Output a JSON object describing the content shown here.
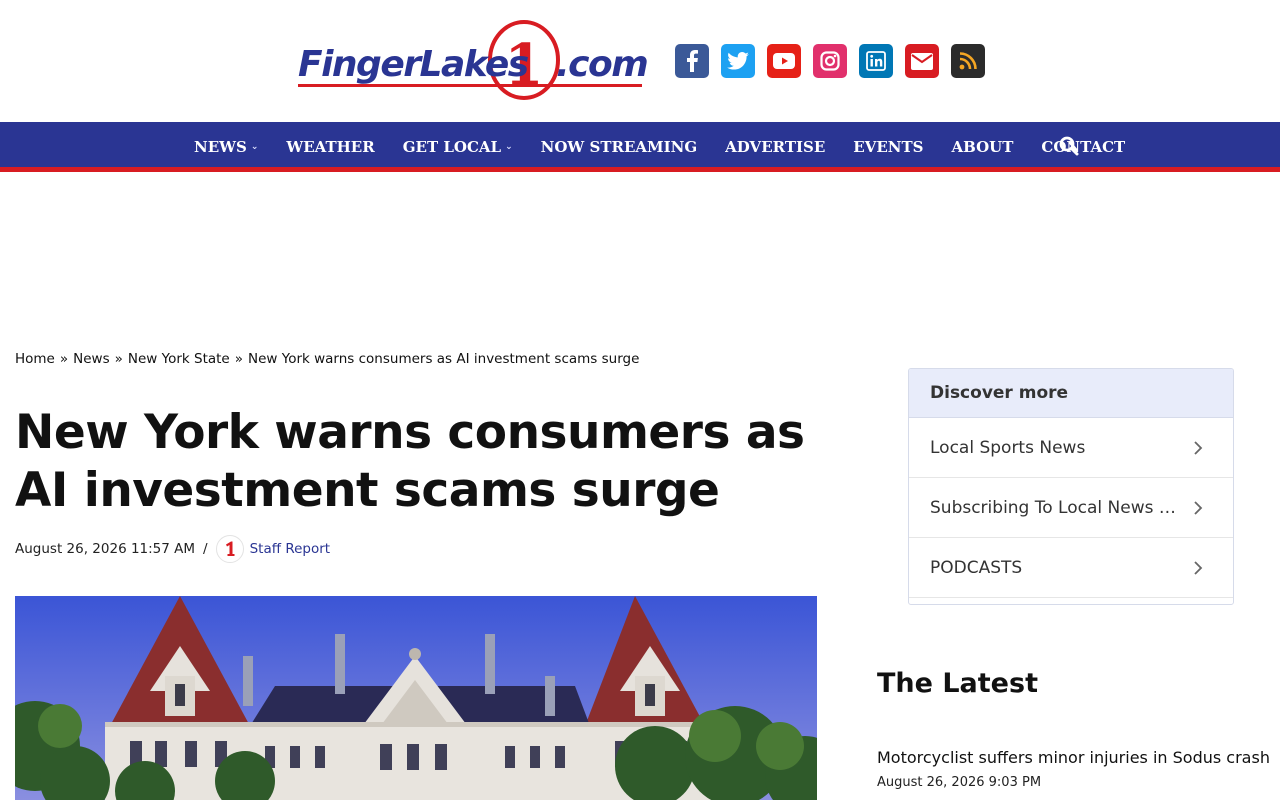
{
  "site": {
    "logo_text_left": "FingerLakes",
    "logo_numeral": "1",
    "logo_text_right": ".com",
    "brand_blue": "#2a3593",
    "brand_red": "#d81c22"
  },
  "social": [
    {
      "name": "facebook-icon",
      "color": "#3b5998"
    },
    {
      "name": "twitter-icon",
      "color": "#1da1f2"
    },
    {
      "name": "youtube-icon",
      "color": "#e62117"
    },
    {
      "name": "instagram-icon",
      "color": "#e1306c"
    },
    {
      "name": "linkedin-icon",
      "color": "#0077b5"
    },
    {
      "name": "email-icon",
      "color": "#d81c22"
    },
    {
      "name": "rss-icon",
      "color": "#2b2b2b"
    }
  ],
  "nav": {
    "items": [
      {
        "label": "NEWS",
        "has_dropdown": true
      },
      {
        "label": "WEATHER",
        "has_dropdown": false
      },
      {
        "label": "GET LOCAL",
        "has_dropdown": true
      },
      {
        "label": "NOW STREAMING",
        "has_dropdown": false
      },
      {
        "label": "ADVERTISE",
        "has_dropdown": false
      },
      {
        "label": "EVENTS",
        "has_dropdown": false
      },
      {
        "label": "ABOUT",
        "has_dropdown": false
      },
      {
        "label": "CONTACT",
        "has_dropdown": false
      }
    ],
    "caret": "⌄"
  },
  "breadcrumb": {
    "items": [
      "Home",
      "News",
      "New York State",
      "New York warns consumers as AI investment scams surge"
    ],
    "separator": "»"
  },
  "article": {
    "title": "New York warns consumers as AI investment scams surge",
    "date": "August 26, 2026 11:57 AM",
    "meta_separator": "/",
    "author": "Staff Report"
  },
  "discover": {
    "heading": "Discover more",
    "items": [
      "Local Sports News",
      "Subscribing To Local News P...",
      "PODCASTS"
    ]
  },
  "latest": {
    "heading": "The Latest",
    "items": [
      {
        "headline": "Motorcyclist suffers minor injuries in Sodus crash",
        "date": "August 26, 2026 9:03 PM"
      }
    ]
  }
}
